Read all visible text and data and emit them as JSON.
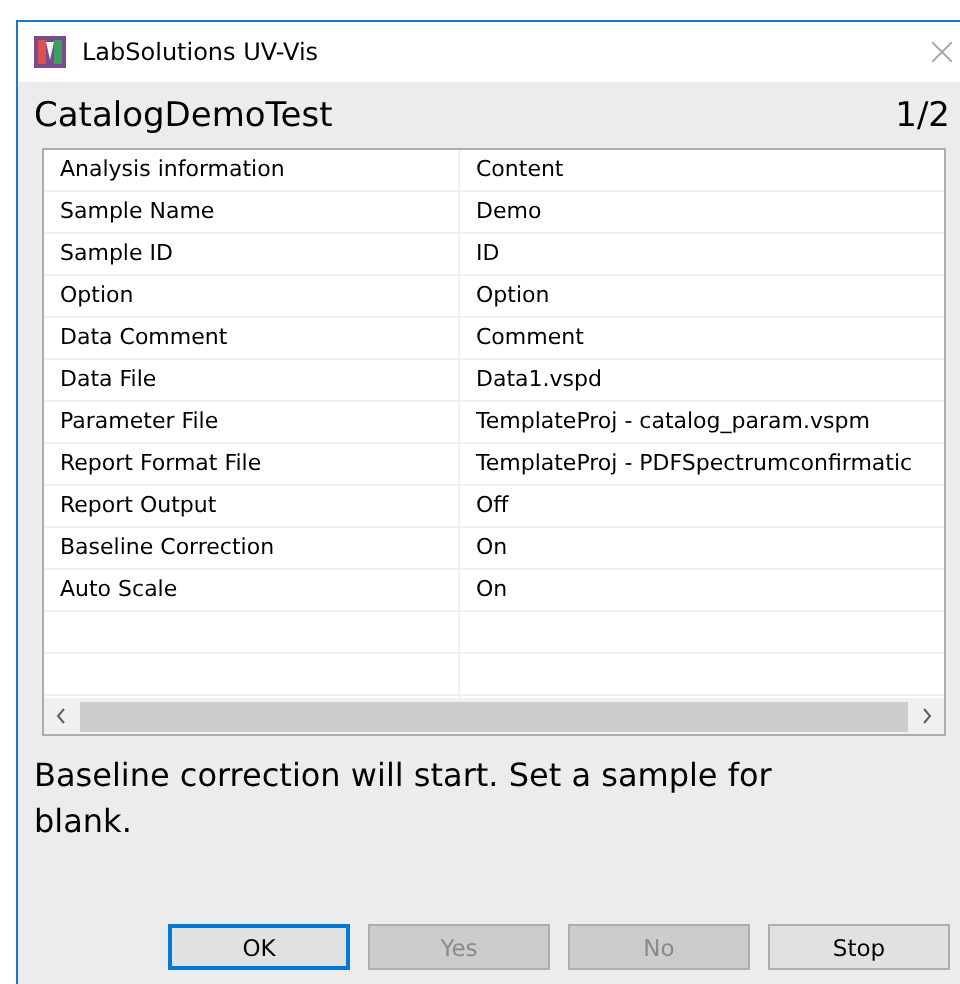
{
  "window": {
    "title": "LabSolutions UV-Vis"
  },
  "header": {
    "title": "CatalogDemoTest",
    "page": "1/2"
  },
  "table": {
    "columns": [
      "Analysis information",
      "Content"
    ],
    "rows": [
      [
        "Sample Name",
        "Demo"
      ],
      [
        "Sample ID",
        "ID"
      ],
      [
        "Option",
        "Option"
      ],
      [
        "Data Comment",
        "Comment"
      ],
      [
        "Data File",
        "Data1.vspd"
      ],
      [
        "Parameter File",
        "TemplateProj - catalog_param.vspm"
      ],
      [
        "Report Format File",
        "TemplateProj - PDFSpectrumconfirmatic"
      ],
      [
        "Report Output",
        "Off"
      ],
      [
        "Baseline Correction",
        "On"
      ],
      [
        "Auto Scale",
        "On"
      ]
    ]
  },
  "message": "Baseline correction will start. Set a sample for blank.",
  "buttons": [
    {
      "label": "OK",
      "disabled": false,
      "default": true
    },
    {
      "label": "Yes",
      "disabled": true,
      "default": false
    },
    {
      "label": "No",
      "disabled": true,
      "default": false
    },
    {
      "label": "Stop",
      "disabled": false,
      "default": false
    }
  ]
}
